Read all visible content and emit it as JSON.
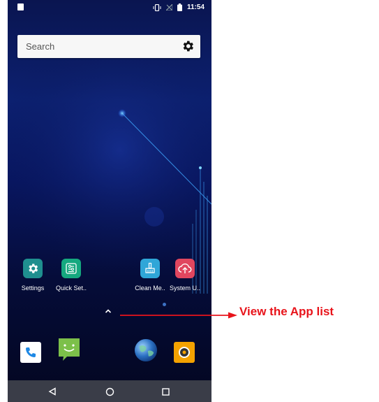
{
  "status_bar": {
    "time": "11:54"
  },
  "search": {
    "placeholder": "Search"
  },
  "home_apps": [
    {
      "label": "Settings",
      "icon": "settings-gear-icon",
      "color": "#1f8f8f"
    },
    {
      "label": "Quick Set..",
      "icon": "sliders-icon",
      "color": "#15a87f"
    },
    {
      "label": "Clean Me..",
      "icon": "broom-icon",
      "color": "#2fa6d8"
    },
    {
      "label": "System U..",
      "icon": "cloud-upload-icon",
      "color": "#e0465f"
    }
  ],
  "dock_apps": [
    {
      "icon": "phone-icon",
      "color": "#ffffff"
    },
    {
      "icon": "message-smile-icon",
      "color": "#7cc04a"
    },
    {
      "icon": "globe-browser-icon",
      "color": "#2a6fc2"
    },
    {
      "icon": "camera-icon",
      "color": "#f4a200"
    }
  ],
  "annotation": {
    "text": "View the App list",
    "color": "#e8141b"
  }
}
